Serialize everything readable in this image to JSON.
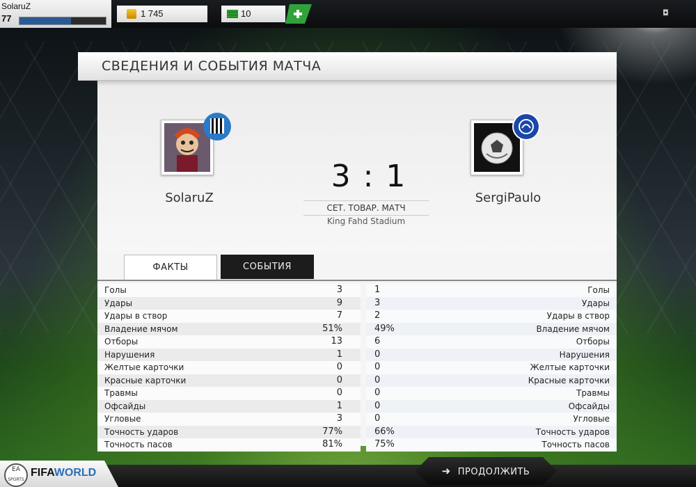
{
  "topbar": {
    "username": "SolaruZ",
    "level": "77",
    "xp_progress": 0.6,
    "coins": "1 745",
    "points": "10",
    "add_button_icon": "plus-icon"
  },
  "panel": {
    "title": "СВЕДЕНИЯ И СОБЫТИЯ МАТЧА",
    "home": {
      "name": "SolaruZ",
      "crest_icon": "newcastle-crest-icon"
    },
    "away": {
      "name": "SergiPaulo",
      "crest_icon": "chelsea-crest-icon"
    },
    "score": "3 : 1",
    "match_type": "СЕТ. ТОВАР. МАТЧ",
    "stadium": "King Fahd Stadium",
    "tabs": {
      "facts": "ФАКТЫ",
      "events": "СОБЫТИЯ"
    },
    "stats": [
      {
        "label": "Голы",
        "home": "3",
        "away": "1"
      },
      {
        "label": "Удары",
        "home": "9",
        "away": "3"
      },
      {
        "label": "Удары в створ",
        "home": "7",
        "away": "2"
      },
      {
        "label": "Владение мячом",
        "home": "51%",
        "away": "49%"
      },
      {
        "label": "Отборы",
        "home": "13",
        "away": "6"
      },
      {
        "label": "Нарушения",
        "home": "1",
        "away": "0"
      },
      {
        "label": "Желтые карточки",
        "home": "0",
        "away": "0"
      },
      {
        "label": "Красные карточки",
        "home": "0",
        "away": "0"
      },
      {
        "label": "Травмы",
        "home": "0",
        "away": "0"
      },
      {
        "label": "Офсайды",
        "home": "1",
        "away": "0"
      },
      {
        "label": "Угловые",
        "home": "3",
        "away": "0"
      },
      {
        "label": "Точность ударов",
        "home": "77%",
        "away": "66%"
      },
      {
        "label": "Точность пасов",
        "home": "81%",
        "away": "75%"
      }
    ]
  },
  "footer": {
    "logo_ea": "EA SPORTS",
    "logo_fifa": "FIFA",
    "logo_world": "WORLD",
    "continue_label": "ПРОДОЛЖИТЬ",
    "continue_icon": "arrow-right-icon"
  },
  "colors": {
    "accent_green": "#2e9a2e",
    "xp_blue": "#2a5a96"
  }
}
